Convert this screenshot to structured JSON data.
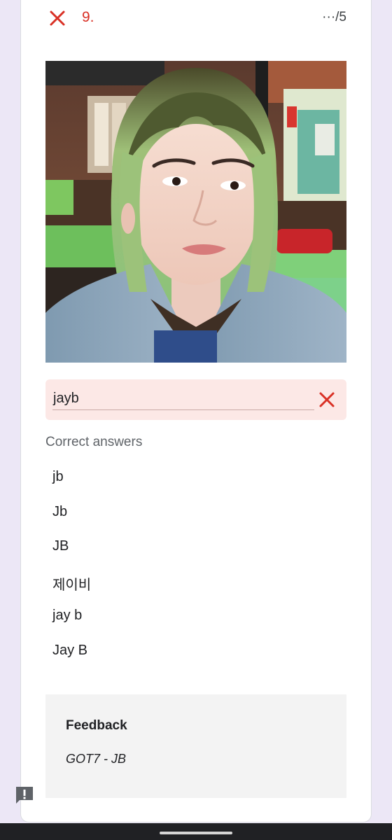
{
  "question": {
    "status": "incorrect",
    "number_label": "9.",
    "score_label": "···/5"
  },
  "image": {
    "description": "photo-portrait"
  },
  "answer": {
    "value": "jayb",
    "status_icon": "incorrect-x-icon"
  },
  "correct_answers": {
    "heading": "Correct answers",
    "items": [
      "jb",
      "Jb",
      "JB",
      "제이비",
      "jay b",
      "Jay B"
    ]
  },
  "feedback": {
    "title": "Feedback",
    "body": "GOT7 - JB"
  },
  "colors": {
    "incorrect": "#d93025",
    "answer_background": "#fce8e6",
    "page_background": "#ece7f6",
    "feedback_background": "#f3f3f3"
  }
}
